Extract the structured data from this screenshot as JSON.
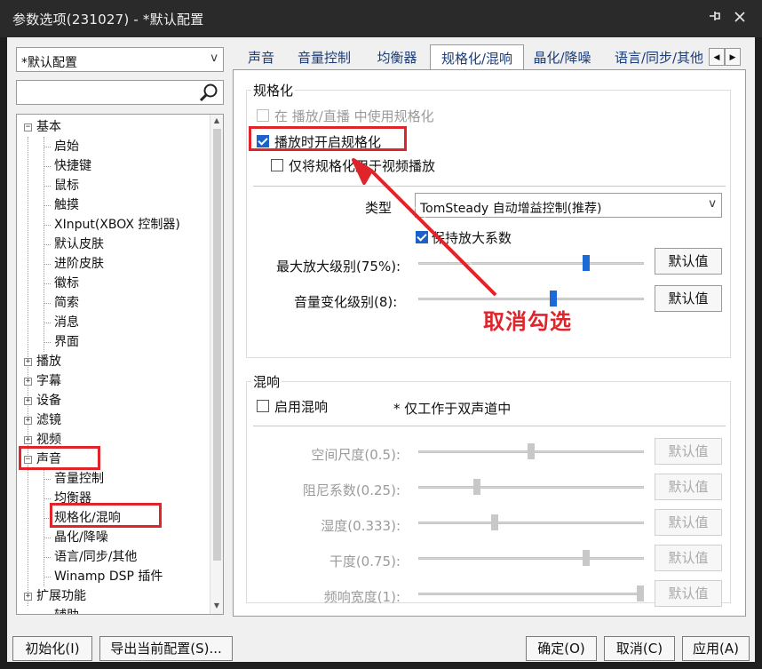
{
  "window": {
    "title": "参数选项(231027) - *默认配置",
    "pin_icon": "pin-icon",
    "close_icon": "close-icon"
  },
  "left": {
    "profile_value": "*默认配置",
    "profile_arrow": "v",
    "search_icon": "magnifier-icon",
    "tree": [
      {
        "label": "基本",
        "expander": "−"
      },
      {
        "label": "启始"
      },
      {
        "label": "快捷键"
      },
      {
        "label": "鼠标"
      },
      {
        "label": "触摸"
      },
      {
        "label": "XInput(XBOX 控制器)"
      },
      {
        "label": "默认皮肤"
      },
      {
        "label": "进阶皮肤"
      },
      {
        "label": "徽标"
      },
      {
        "label": "简索"
      },
      {
        "label": "消息"
      },
      {
        "label": "界面"
      },
      {
        "label": "播放",
        "expander": "+"
      },
      {
        "label": "字幕",
        "expander": "+"
      },
      {
        "label": "设备",
        "expander": "+"
      },
      {
        "label": "滤镜",
        "expander": "+"
      },
      {
        "label": "视频",
        "expander": "+"
      },
      {
        "label": "声音",
        "expander": "−"
      },
      {
        "label": "音量控制"
      },
      {
        "label": "均衡器"
      },
      {
        "label": "规格化/混响"
      },
      {
        "label": "晶化/降噪"
      },
      {
        "label": "语言/同步/其他"
      },
      {
        "label": "Winamp DSP 插件"
      },
      {
        "label": "扩展功能",
        "expander": "+"
      },
      {
        "label": "辅助"
      }
    ]
  },
  "tabs": [
    {
      "label": "声音"
    },
    {
      "label": "音量控制"
    },
    {
      "label": "均衡器"
    },
    {
      "label": "规格化/混响",
      "active": true
    },
    {
      "label": "晶化/降噪"
    },
    {
      "label": "语言/同步/其他"
    }
  ],
  "tab_scroll": {
    "left": "◀",
    "right": "▶"
  },
  "normalize": {
    "group_title": "规格化",
    "use_during_live": "在 播放/直播 中使用规格化",
    "enable_on_play": "播放时开启规格化",
    "video_only": "仅将规格化用于视频播放",
    "type_label": "类型",
    "type_value": "TomSteady 自动增益控制(推荐)",
    "type_arrow": "v",
    "keep_ratio": "保持放大系数",
    "max_label": "最大放大级别(75%):",
    "max_level": 0.75,
    "volume_label": "音量变化级别(8):",
    "volume_level": 0.6,
    "default_label": "默认值"
  },
  "reverb": {
    "group_title": "混响",
    "enable": "启用混响",
    "note": "* 仅工作于双声道中",
    "rows": [
      {
        "label": "空间尺度(0.5):",
        "value": 0.5
      },
      {
        "label": "阻尼系数(0.25):",
        "value": 0.25
      },
      {
        "label": "湿度(0.333):",
        "value": 0.333
      },
      {
        "label": "干度(0.75):",
        "value": 0.75
      },
      {
        "label": "频响宽度(1):",
        "value": 1.0
      }
    ],
    "default_label": "默认值"
  },
  "annotation": {
    "text": "取消勾选"
  },
  "bottom": {
    "init": "初始化(I)",
    "export": "导出当前配置(S)...",
    "ok": "确定(O)",
    "cancel": "取消(C)",
    "apply": "应用(A)"
  }
}
